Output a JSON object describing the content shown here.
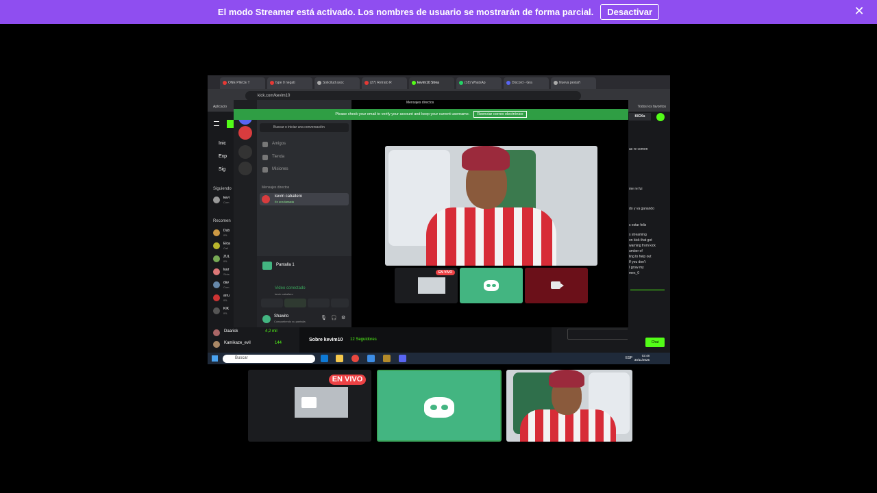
{
  "banner": {
    "message": "El modo Streamer está activado. Los nombres de usuario se mostrarán de forma parcial.",
    "button": "Desactivar",
    "close": "✕"
  },
  "browser": {
    "tabs": [
      "ONE PIECE T",
      "type 0 negati",
      "Solicitud asoc",
      "(27) Retrato R",
      "kevim10 Strea",
      "(18) WhatsAp",
      "Discord - Gra",
      "Nueva pestañ"
    ],
    "url": "kick.com/kevim10",
    "bookmarks_left": "Aplicacio",
    "bookmarks_right": "Todos los favoritos",
    "window_title": "Mensajes directos"
  },
  "kick": {
    "nav": [
      "Inic",
      "Exp",
      "Sig"
    ],
    "following_label": "Siguiendo",
    "following": [
      {
        "name": "kevi",
        "sub": "Com"
      }
    ],
    "recommended_label": "Recomen",
    "channels": [
      {
        "name": "Dub",
        "sub": "IRL"
      },
      {
        "name": "Elca",
        "sub": "Call"
      },
      {
        "name": "ZUL",
        "sub": "IRL"
      },
      {
        "name": "luur",
        "sub": "Slots"
      },
      {
        "name": "dav",
        "sub": "Com"
      },
      {
        "name": "arru",
        "sub": "IRL"
      },
      {
        "name": "KIK",
        "sub": "IRL"
      },
      {
        "name": "Daarick",
        "sub": "IRL"
      },
      {
        "name": "Kamikaze_evil",
        "sub": ""
      }
    ],
    "viewers": [
      {
        "name": "Daarick",
        "count": "4,2 mil"
      },
      {
        "name": "Kamikaze_evil",
        "count": "144"
      }
    ],
    "about": "Sobre kevim10",
    "followers": "12 Seguidores",
    "kicks_label": "KICKs",
    "chat_button": "Chat",
    "chat_lines": [
      "as re comen",
      "me re fui",
      "do y va ganando",
      "s estar feliz",
      "s streaming",
      "on kick that got",
      "warning from kick",
      "umber of",
      "ling to help out",
      "If you don't",
      "I grow my",
      "mex_0"
    ]
  },
  "discord": {
    "verify_text": "Please check your email to verify your account and keep your current username.",
    "verify_button": "Reenviar correo electrónico",
    "search": "Buscar o iniciar una conversación",
    "menu": [
      "Amigos",
      "Tienda",
      "Misiones"
    ],
    "dm_header": "Mensajes directos",
    "dm_name": "kevin caballero",
    "dm_status": "En una llamada",
    "screen_label": "Pantalla 1",
    "video_connected": "Video conectado",
    "video_sub": "kevin caballero",
    "user_name": "Shawito",
    "user_status": "Compartiendo su pantalla",
    "live_small": "EN VIVO"
  },
  "taskbar": {
    "search": "Buscar",
    "lang": "ESP",
    "time": "02:48",
    "date": "30/11/2025"
  },
  "bottom": {
    "live": "EN VIVO"
  },
  "colors": {
    "banner": "#8f4ef0",
    "kick_green": "#53fc18",
    "discord_green": "#43b581",
    "discord_blurple": "#5865f2",
    "live_red": "#ed4245"
  }
}
